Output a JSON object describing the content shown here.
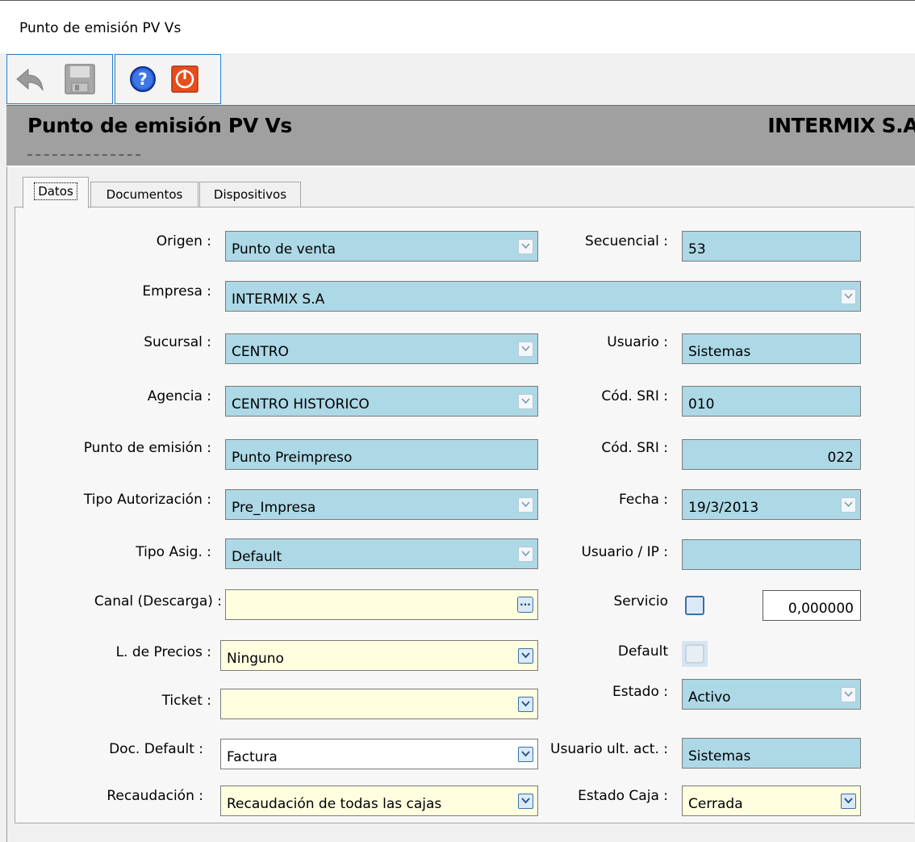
{
  "window": {
    "title": "Punto de emisión PV Vs"
  },
  "toolbar": {
    "undo": "undo-arrow-icon",
    "save": "floppy-disk-icon",
    "help": "question-mark-icon",
    "exit": "power-off-icon"
  },
  "header": {
    "title": "Punto de emisión PV Vs",
    "company": "INTERMIX S.A"
  },
  "tabs": [
    "Datos",
    "Documentos",
    "Dispositivos"
  ],
  "form": {
    "origen": {
      "label": "Origen :",
      "value": "Punto de venta"
    },
    "secuencial": {
      "label": "Secuencial :",
      "value": "53"
    },
    "empresa": {
      "label": "Empresa :",
      "value": "INTERMIX S.A"
    },
    "sucursal": {
      "label": "Sucursal :",
      "value": "CENTRO"
    },
    "usuario": {
      "label": "Usuario :",
      "value": "Sistemas"
    },
    "agencia": {
      "label": "Agencia :",
      "value": "CENTRO HISTORICO"
    },
    "cod_sri_1": {
      "label": "Cód. SRI :",
      "value": "010"
    },
    "punto_emision": {
      "label": "Punto de emisión :",
      "value": "Punto Preimpreso"
    },
    "cod_sri_2": {
      "label": "Cód. SRI :",
      "value": "022"
    },
    "tipo_autorizacion": {
      "label": "Tipo Autorización :",
      "value": "Pre_Impresa"
    },
    "fecha": {
      "label": "Fecha :",
      "value": "19/3/2013"
    },
    "tipo_asig": {
      "label": "Tipo Asig. :",
      "value": "Default"
    },
    "usuario_ip": {
      "label": "Usuario / IP :",
      "value": ""
    },
    "canal": {
      "label": "Canal (Descarga) :",
      "value": "",
      "button": "..."
    },
    "servicio": {
      "label": "Servicio",
      "value": "0,000000",
      "checked": false
    },
    "lista_precios": {
      "label": "L. de Precios :",
      "value": "Ninguno"
    },
    "default": {
      "label": "Default",
      "checked": false
    },
    "ticket": {
      "label": "Ticket :",
      "value": ""
    },
    "estado": {
      "label": "Estado :",
      "value": "Activo"
    },
    "doc_default": {
      "label": "Doc. Default :",
      "value": "Factura"
    },
    "usuario_ult_act": {
      "label": "Usuario ult. act. :",
      "value": "Sistemas"
    },
    "recaudacion": {
      "label": "Recaudación :",
      "value": "Recaudación de todas las cajas"
    },
    "estado_caja": {
      "label": "Estado Caja :",
      "value": "Cerrada"
    }
  }
}
